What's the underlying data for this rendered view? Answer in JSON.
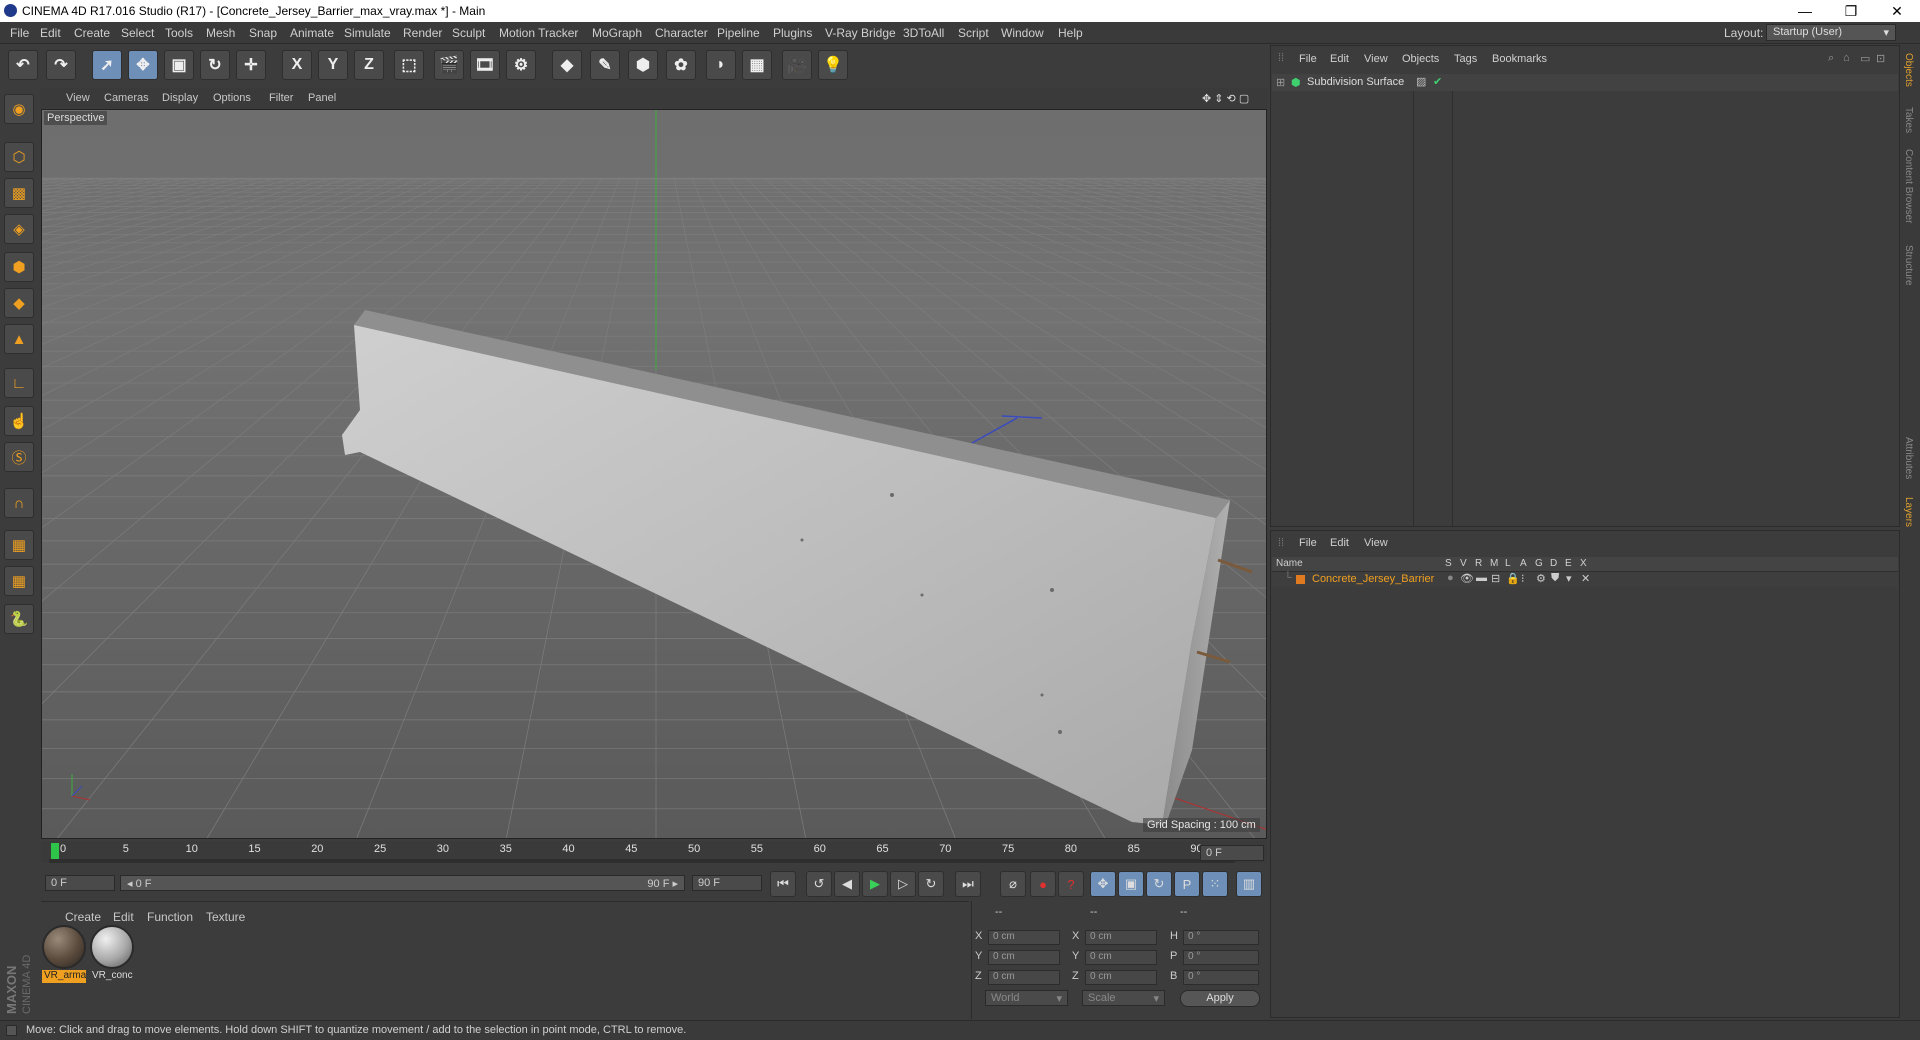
{
  "window": {
    "title": "CINEMA 4D R17.016 Studio (R17) - [Concrete_Jersey_Barrier_max_vray.max *] - Main",
    "controls": {
      "minimize": "—",
      "restore": "❐",
      "close": "✕"
    }
  },
  "menubar": {
    "items": [
      "File",
      "Edit",
      "Create",
      "Select",
      "Tools",
      "Mesh",
      "Snap",
      "Animate",
      "Simulate",
      "Render",
      "Sculpt",
      "Motion Tracker",
      "MoGraph",
      "Character",
      "Pipeline",
      "Plugins",
      "V-Ray Bridge",
      "3DToAll",
      "Script",
      "Window",
      "Help"
    ],
    "layout_label": "Layout:",
    "layout_value": "Startup (User)"
  },
  "toolbar": {
    "buttons": [
      {
        "name": "undo-icon",
        "glyph": "↶"
      },
      {
        "name": "redo-icon",
        "glyph": "↷"
      },
      {
        "name": "select-arrow-icon",
        "glyph": "➚"
      },
      {
        "name": "move-icon",
        "glyph": "✥"
      },
      {
        "name": "scale-icon",
        "glyph": "▣"
      },
      {
        "name": "rotate-icon",
        "glyph": "↻"
      },
      {
        "name": "move-alt-icon",
        "glyph": "✛"
      },
      {
        "name": "axis-x-icon",
        "glyph": "X"
      },
      {
        "name": "axis-y-icon",
        "glyph": "Y"
      },
      {
        "name": "axis-z-icon",
        "glyph": "Z"
      },
      {
        "name": "coordinate-system-icon",
        "glyph": "⬚"
      },
      {
        "name": "render-view-icon",
        "glyph": "🎬"
      },
      {
        "name": "render-picture-viewer-icon",
        "glyph": "🎞"
      },
      {
        "name": "render-settings-icon",
        "glyph": "⚙"
      },
      {
        "name": "cube-icon",
        "glyph": "◆"
      },
      {
        "name": "spline-pen-icon",
        "glyph": "✎"
      },
      {
        "name": "subdivision-icon",
        "glyph": "⬢"
      },
      {
        "name": "cloner-icon",
        "glyph": "✿"
      },
      {
        "name": "deformer-icon",
        "glyph": "◗"
      },
      {
        "name": "floor-icon",
        "glyph": "▦"
      },
      {
        "name": "camera-icon",
        "glyph": "🎥"
      },
      {
        "name": "light-icon",
        "glyph": "💡"
      }
    ]
  },
  "leftbar": {
    "tools": [
      "make-editable-icon",
      "model-mode-icon",
      "texture-mode-icon",
      "workplane-icon",
      "points-mode-icon",
      "edges-mode-icon",
      "polygons-mode-icon",
      "axis-mode-icon",
      "tweak-icon",
      "snap-icon",
      "magnet-icon",
      "grid-lock-icon",
      "grid-snap-icon",
      "python-icon"
    ]
  },
  "viewport": {
    "menu": [
      "View",
      "Cameras",
      "Display",
      "Options",
      "Filter",
      "Panel"
    ],
    "camera_label": "Perspective",
    "grid_spacing": "Grid Spacing : 100 cm"
  },
  "timeline": {
    "ticks": [
      "0",
      "5",
      "10",
      "15",
      "20",
      "25",
      "30",
      "35",
      "40",
      "45",
      "50",
      "55",
      "60",
      "65",
      "70",
      "75",
      "80",
      "85",
      "90"
    ],
    "current_frame_field": "0 F",
    "start_field": "0 F",
    "range_start": "◂ 0 F",
    "range_end": "90 F ▸",
    "end_field": "90 F"
  },
  "transport": {
    "buttons": [
      {
        "name": "go-to-start-icon",
        "glyph": "⏮"
      },
      {
        "name": "prev-key-icon",
        "glyph": "↺"
      },
      {
        "name": "play-backward-icon",
        "glyph": "◀"
      },
      {
        "name": "play-forward-icon",
        "glyph": "▶"
      },
      {
        "name": "next-frame-icon",
        "glyph": "▷"
      },
      {
        "name": "loop-icon",
        "glyph": "↻"
      },
      {
        "name": "go-to-end-icon",
        "glyph": "⏭"
      },
      {
        "name": "keyframe-disabled-icon",
        "glyph": "⌀"
      },
      {
        "name": "record-keys-icon",
        "glyph": "●"
      },
      {
        "name": "autokey-icon",
        "glyph": "?"
      },
      {
        "name": "key-position-icon",
        "glyph": "✥"
      },
      {
        "name": "key-scale-icon",
        "glyph": "▣"
      },
      {
        "name": "key-rotation-icon",
        "glyph": "↻"
      },
      {
        "name": "key-param-icon",
        "glyph": "P"
      },
      {
        "name": "key-pla-icon",
        "glyph": "⁙"
      },
      {
        "name": "timeline-editor-icon",
        "glyph": "▥"
      }
    ]
  },
  "materials": {
    "menu": [
      "Create",
      "Edit",
      "Function",
      "Texture"
    ],
    "items": [
      {
        "label": "VR_arma",
        "color": "#5a4a3c"
      },
      {
        "label": "VR_conc",
        "color": "#a8a8a8"
      }
    ]
  },
  "coordinates": {
    "header": [
      "--",
      "--",
      "--"
    ],
    "rows": [
      {
        "a": "X",
        "av": "0 cm",
        "b": "X",
        "bv": "0 cm",
        "c": "H",
        "cv": "0 °"
      },
      {
        "a": "Y",
        "av": "0 cm",
        "b": "Y",
        "bv": "0 cm",
        "c": "P",
        "cv": "0 °"
      },
      {
        "a": "Z",
        "av": "0 cm",
        "b": "Z",
        "bv": "0 cm",
        "c": "B",
        "cv": "0 °"
      }
    ],
    "world_select": "World",
    "scale_select": "Scale",
    "apply": "Apply"
  },
  "object_manager": {
    "menu": [
      "File",
      "Edit",
      "View",
      "Objects",
      "Tags",
      "Bookmarks"
    ],
    "objects": [
      {
        "name": "Subdivision Surface"
      }
    ]
  },
  "layer_manager": {
    "menu": [
      "File",
      "Edit",
      "View"
    ],
    "columns": [
      "Name",
      "S",
      "V",
      "R",
      "M",
      "L",
      "A",
      "G",
      "D",
      "E",
      "X"
    ],
    "layers": [
      {
        "name": "Concrete_Jersey_Barrier",
        "color": "#e07a20"
      }
    ]
  },
  "right_tabs": [
    "Objects",
    "Takes",
    "Content Browser",
    "Structure",
    "Attributes",
    "Layers"
  ],
  "status": "Move: Click and drag to move elements. Hold down SHIFT to quantize movement / add to the selection in point mode, CTRL to remove.",
  "brand": {
    "line1": "MAXON",
    "line2": "CINEMA 4D"
  },
  "colors": {
    "accent": "#f0a020",
    "selected_button": "#6d8fb8",
    "background": "#3c3c3c"
  }
}
